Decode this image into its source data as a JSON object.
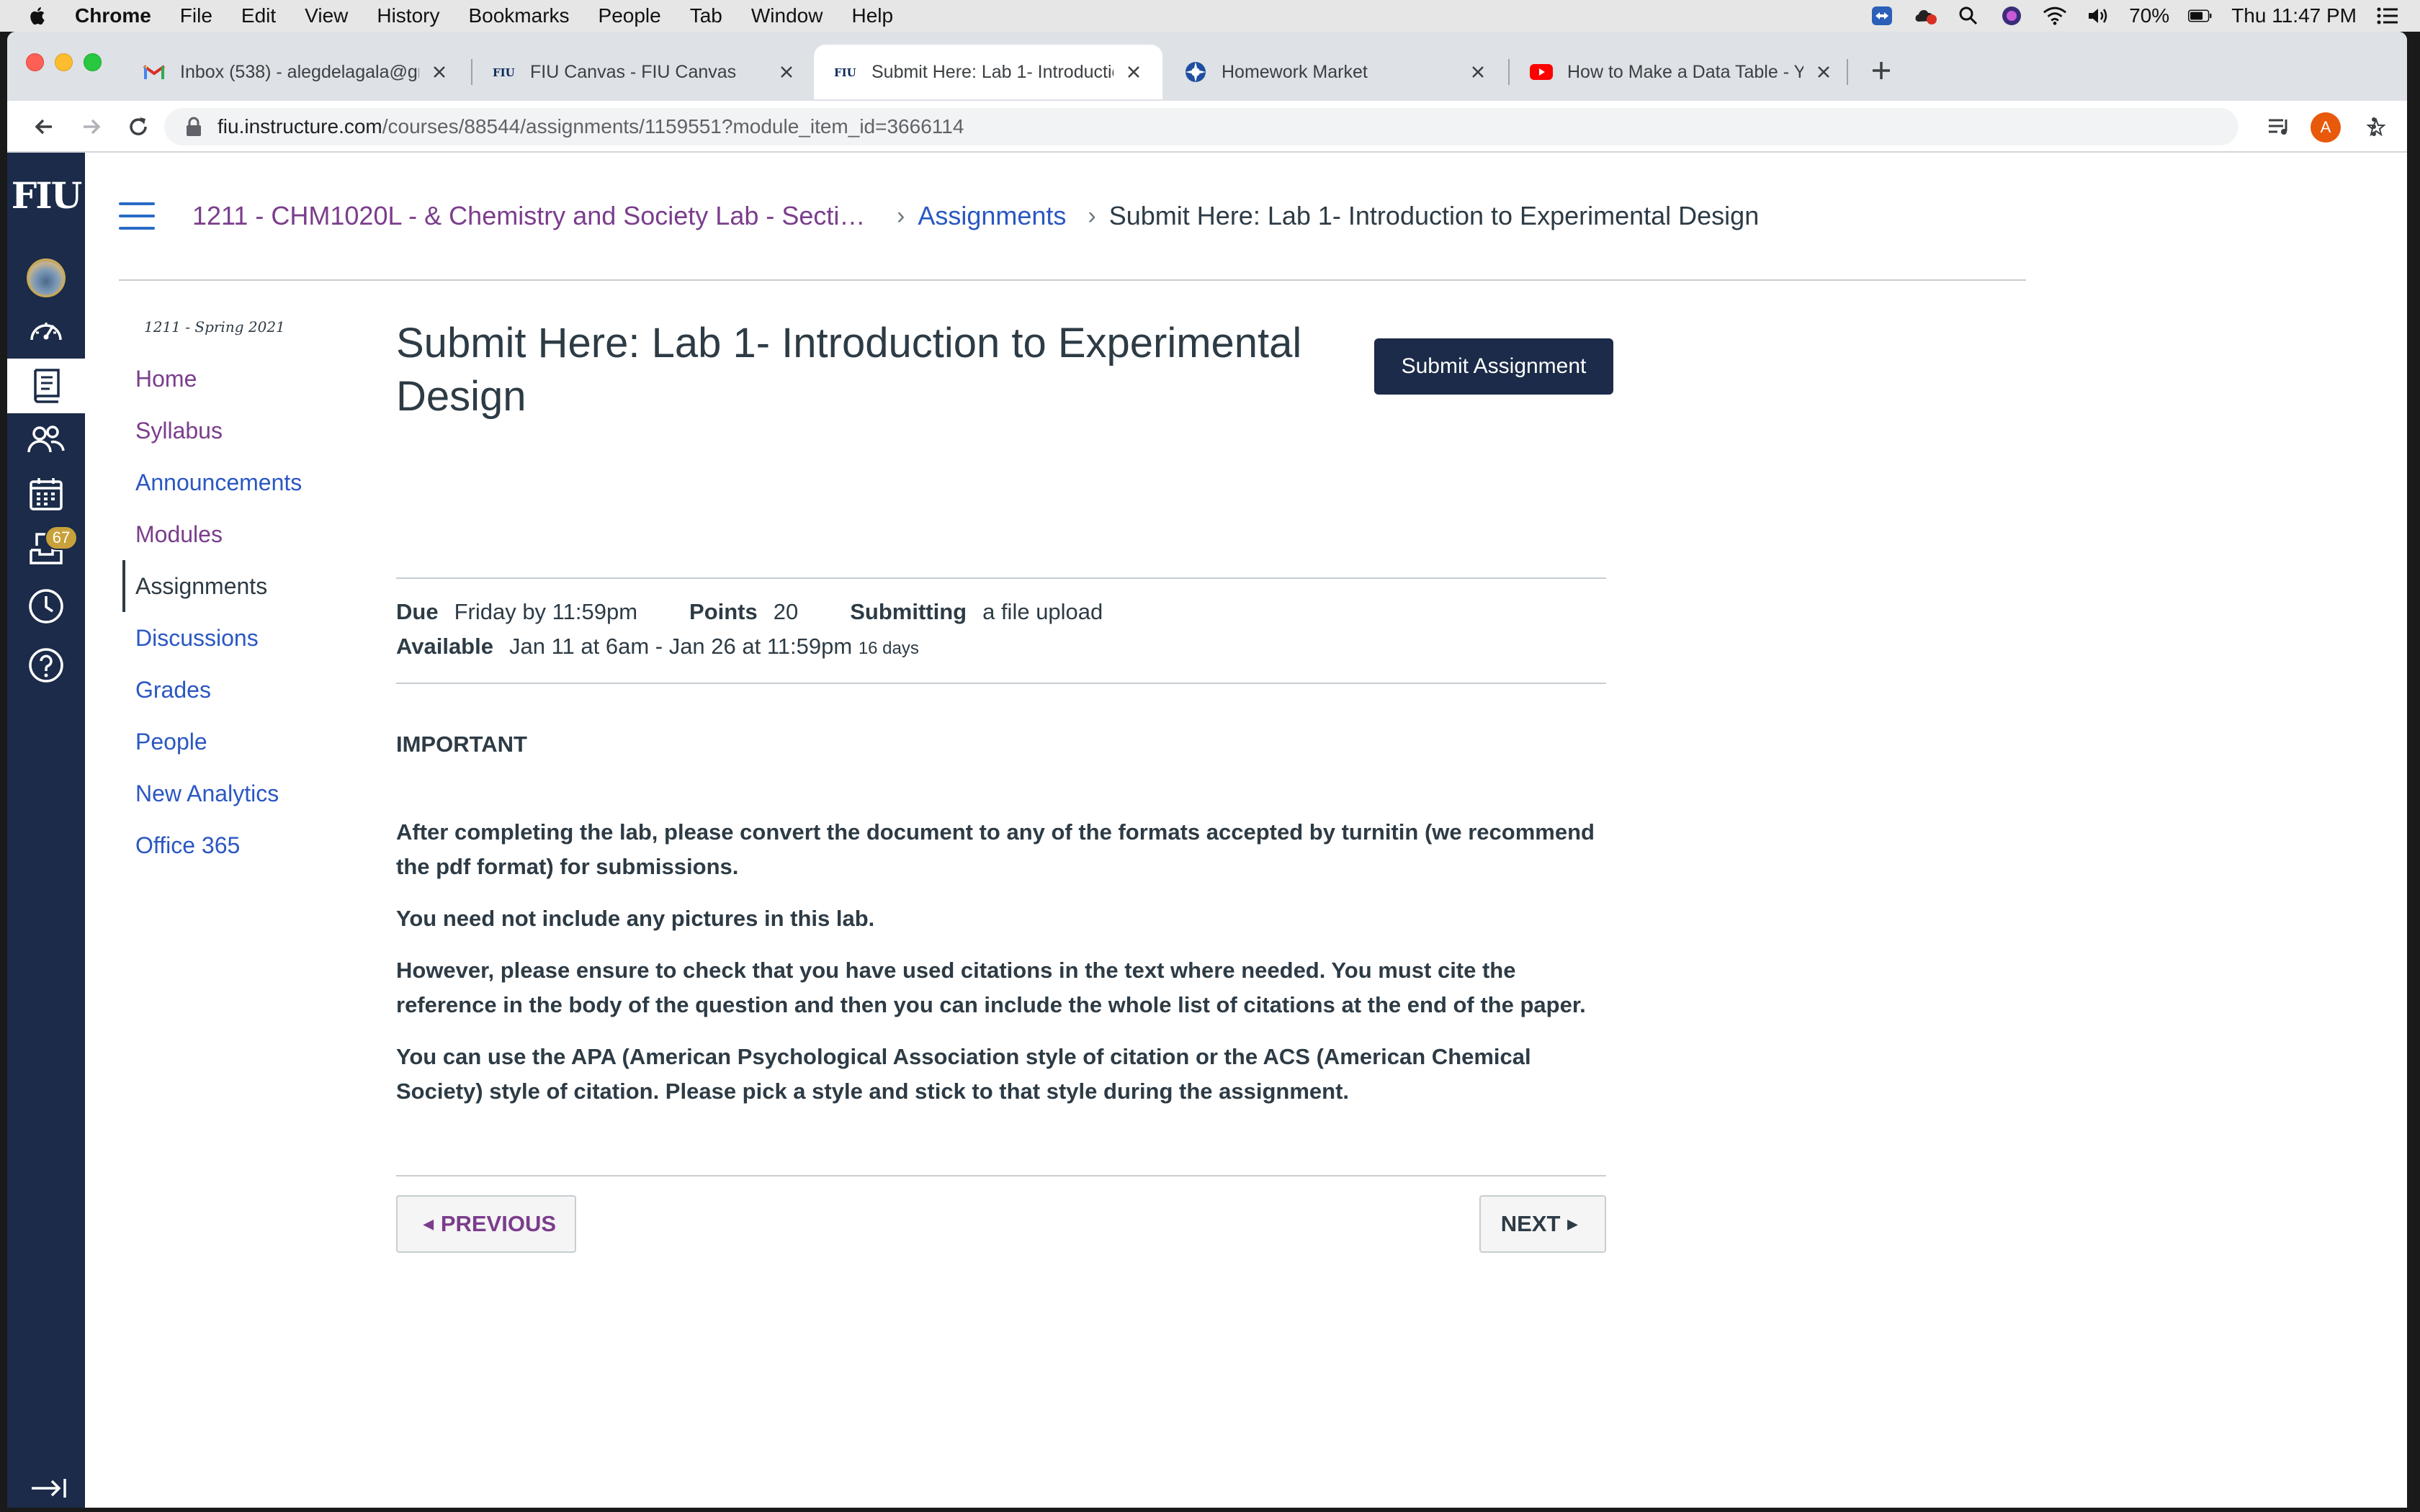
{
  "menubar": {
    "app_name": "Chrome",
    "menus": [
      "File",
      "Edit",
      "View",
      "History",
      "Bookmarks",
      "People",
      "Tab",
      "Window",
      "Help"
    ],
    "battery": "70%",
    "clock": "Thu 11:47 PM"
  },
  "tabs": [
    {
      "title": "Inbox (538) - alegdelagala@gm",
      "icon": "gmail-icon"
    },
    {
      "title": "FIU Canvas - FIU Canvas",
      "icon": "fiu-icon"
    },
    {
      "title": "Submit Here: Lab 1- Introductio",
      "icon": "fiu-icon",
      "active": true
    },
    {
      "title": "Homework Market",
      "icon": "homework-market-icon"
    },
    {
      "title": "How to Make a Data Table - Yo",
      "icon": "youtube-icon"
    }
  ],
  "address_bar": {
    "host": "fiu.instructure.com",
    "path": "/courses/88544/assignments/1159551?module_item_id=3666114"
  },
  "profile_initial": "A",
  "global_nav": {
    "logo": "FIU",
    "inbox_badge": "67"
  },
  "breadcrumb": {
    "course": "1211 - CHM1020L - & Chemistry and Society Lab - Sectio...",
    "section": "Assignments",
    "current": "Submit Here: Lab 1- Introduction to Experimental Design"
  },
  "course_nav": {
    "term": "1211 - Spring 2021",
    "items": [
      "Home",
      "Syllabus",
      "Announcements",
      "Modules",
      "Assignments",
      "Discussions",
      "Grades",
      "People",
      "New Analytics",
      "Office 365"
    ]
  },
  "assignment": {
    "title": "Submit Here: Lab 1- Introduction to Experimental Design",
    "submit_label": "Submit Assignment",
    "due_label": "Due",
    "due_value": "Friday by 11:59pm",
    "points_label": "Points",
    "points_value": "20",
    "submitting_label": "Submitting",
    "submitting_value": "a file upload",
    "available_label": "Available",
    "available_value": "Jan 11 at 6am - Jan 26 at 11:59pm",
    "available_days": "16 days",
    "heading": "IMPORTANT",
    "paragraphs": [
      "After completing the lab, please convert the document to any of the formats accepted by turnitin (we recommend the pdf format) for submissions.",
      "You need not include any pictures in this lab.",
      "However, please ensure to check that you have used citations in the text where needed. You must cite the reference in the body of the question and then you can include the whole list of citations at the end of the paper.",
      "You can use the APA (American Psychological Association style of citation or the ACS (American Chemical Society) style of citation. Please pick a style and stick to that style during the assignment."
    ]
  },
  "pager": {
    "previous": "PREVIOUS",
    "next": "NEXT"
  },
  "colors": {
    "canvas_nav": "#1b2b49",
    "link": "#2a57c2",
    "visited_link": "#7b3d8c",
    "text": "#2d3b45",
    "badge": "#c8a13a"
  }
}
